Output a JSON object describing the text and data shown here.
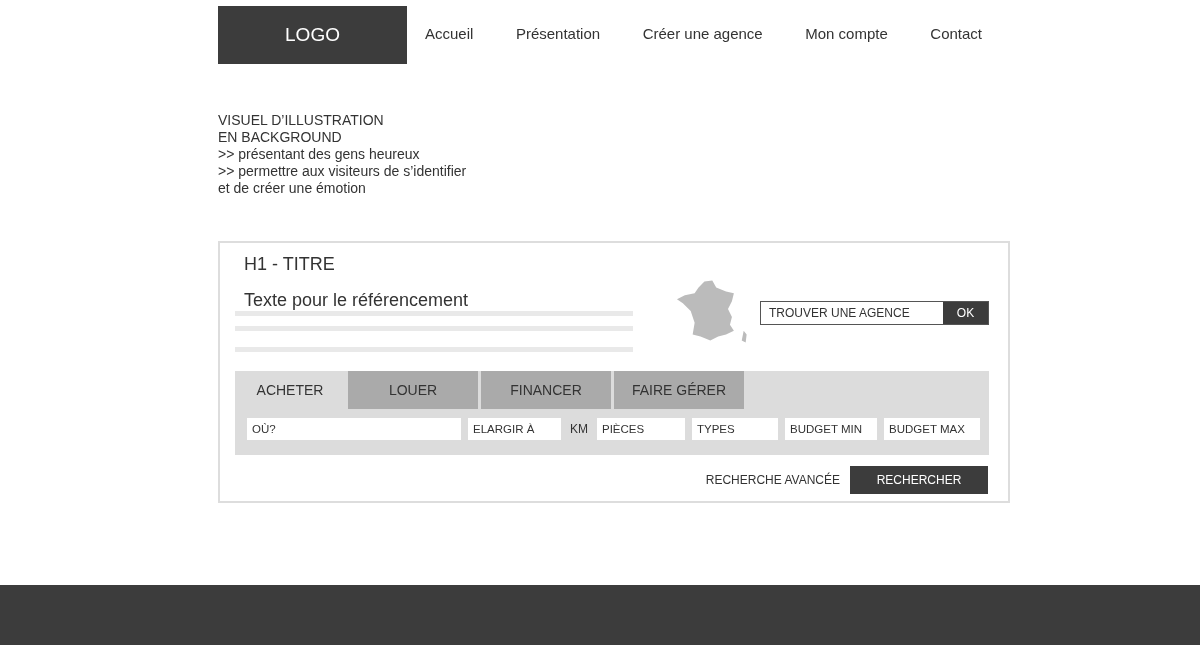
{
  "header": {
    "logo": "LOGO",
    "nav": [
      {
        "label": "Accueil"
      },
      {
        "label": "Présentation"
      },
      {
        "label": "Créer une agence"
      },
      {
        "label": "Mon compte"
      },
      {
        "label": "Contact"
      }
    ]
  },
  "hero_note": [
    "VISUEL D’ILLUSTRATION",
    "EN BACKGROUND",
    ">> présentant des gens heureux",
    ">> permettre aux visiteurs de s’identifier",
    "et de créer une émotion"
  ],
  "search_card": {
    "title": "H1 - TITRE",
    "subtitle": "Texte pour le référencement",
    "agency_search": {
      "placeholder": "TROUVER UNE AGENCE",
      "button": "OK"
    },
    "tabs": [
      {
        "label": "ACHETER",
        "selected": true
      },
      {
        "label": "LOUER",
        "selected": false
      },
      {
        "label": "FINANCER",
        "selected": false
      },
      {
        "label": "FAIRE GÉRER",
        "selected": false
      }
    ],
    "fields": [
      {
        "kind": "field",
        "placeholder": "OÙ?"
      },
      {
        "kind": "field",
        "placeholder": "ELARGIR À"
      },
      {
        "kind": "unit",
        "label": "KM"
      },
      {
        "kind": "field",
        "placeholder": "PIÈCES"
      },
      {
        "kind": "field",
        "placeholder": "TYPES"
      },
      {
        "kind": "field",
        "placeholder": "BUDGET MIN"
      },
      {
        "kind": "field",
        "placeholder": "BUDGET MAX"
      }
    ],
    "advanced_link": "RECHERCHE AVANCÉE",
    "search_button": "RECHERCHER"
  }
}
